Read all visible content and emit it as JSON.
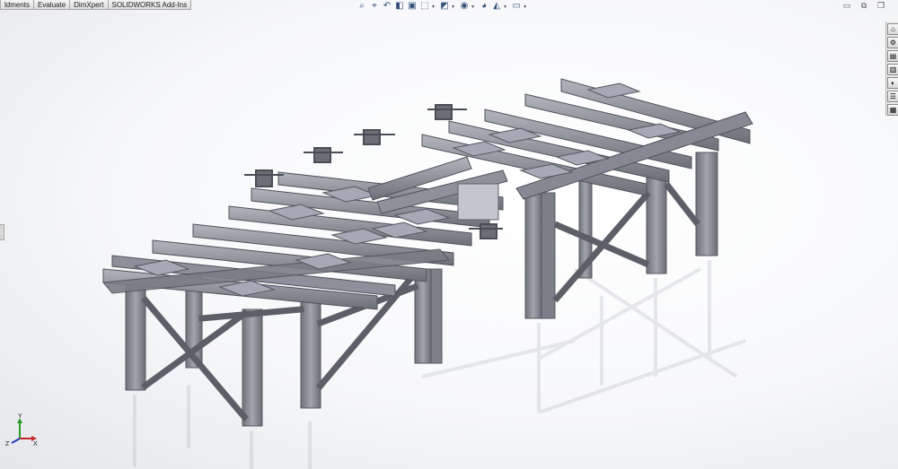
{
  "command_manager": {
    "tabs": [
      "ldments",
      "Evaluate",
      "DimXpert",
      "SOLIDWORKS Add-Ins"
    ]
  },
  "heads_up_toolbar": {
    "icons": [
      "zoom-to-fit-icon",
      "zoom-to-area-icon",
      "previous-view-icon",
      "section-view-icon",
      "dynamic-annotation-icon",
      "view-orientation-icon",
      "display-style-icon",
      "hide-show-items-icon",
      "edit-appearance-icon",
      "apply-scene-icon",
      "view-settings-icon"
    ]
  },
  "window_controls": {
    "minimize": "▭",
    "restore": "⧉",
    "maximize": "❐",
    "close": "×"
  },
  "task_pane": {
    "icons": [
      "home-icon",
      "solidworks-resources-icon",
      "design-library-icon",
      "file-explorer-icon",
      "appearances-icon",
      "custom-properties-icon",
      "view-palette-icon"
    ]
  },
  "triad": {
    "x": "X",
    "y": "Y",
    "z": "Z"
  },
  "colors": {
    "steel": "#8c8f98",
    "steel_dark": "#5d6068",
    "plate": "#a3a6b2",
    "reflection": "#c9ccd4"
  }
}
